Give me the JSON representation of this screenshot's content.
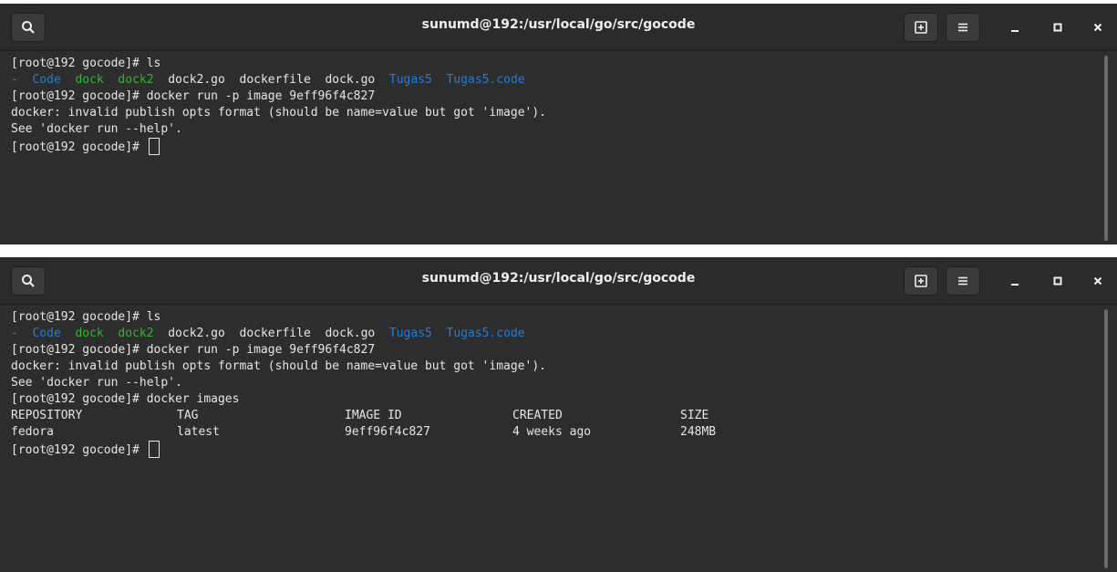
{
  "colors": {
    "background": "#2d2d2d",
    "text": "#e6e6e6",
    "directory": "#2a7bd1",
    "executable": "#33b533"
  },
  "windows": [
    {
      "title": "sunumd@192:/usr/local/go/src/gocode",
      "icons": {
        "search": "search-icon",
        "new_tab": "new-tab-icon",
        "menu": "hamburger-menu-icon",
        "minimize": "minimize-icon",
        "maximize": "maximize-icon",
        "close": "close-icon"
      },
      "lines": {
        "l1": "[root@192 gocode]# ls",
        "ls_prefix": "- ",
        "ls_code": "Code",
        "ls_dock": "dock",
        "ls_dock2": "dock2",
        "ls_dock2go": "dock2.go",
        "ls_dockerfile": "dockerfile",
        "ls_dockgo": "dock.go",
        "ls_tugas5": "Tugas5",
        "ls_tugas5code": "Tugas5.code",
        "l3": "[root@192 gocode]# docker run -p image 9eff96f4c827",
        "l4": "docker: invalid publish opts format (should be name=value but got 'image').",
        "l5": "See 'docker run --help'.",
        "prompt": "[root@192 gocode]# "
      }
    },
    {
      "title": "sunumd@192:/usr/local/go/src/gocode",
      "icons": {
        "search": "search-icon",
        "new_tab": "new-tab-icon",
        "menu": "hamburger-menu-icon",
        "minimize": "minimize-icon",
        "maximize": "maximize-icon",
        "close": "close-icon"
      },
      "lines": {
        "l1": "[root@192 gocode]# ls",
        "ls_prefix": "- ",
        "ls_code": "Code",
        "ls_dock": "dock",
        "ls_dock2": "dock2",
        "ls_dock2go": "dock2.go",
        "ls_dockerfile": "dockerfile",
        "ls_dockgo": "dock.go",
        "ls_tugas5": "Tugas5",
        "ls_tugas5code": "Tugas5.code",
        "l3": "[root@192 gocode]# docker run -p image 9eff96f4c827",
        "l4": "docker: invalid publish opts format (should be name=value but got 'image').",
        "l5": "See 'docker run --help'.",
        "l6": "[root@192 gocode]# docker images",
        "prompt": "[root@192 gocode]# "
      },
      "images_table": {
        "headers": [
          "REPOSITORY",
          "TAG",
          "IMAGE ID",
          "CREATED",
          "SIZE"
        ],
        "rows": [
          [
            "fedora",
            "latest",
            "9eff96f4c827",
            "4 weeks ago",
            "248MB"
          ]
        ]
      }
    }
  ]
}
